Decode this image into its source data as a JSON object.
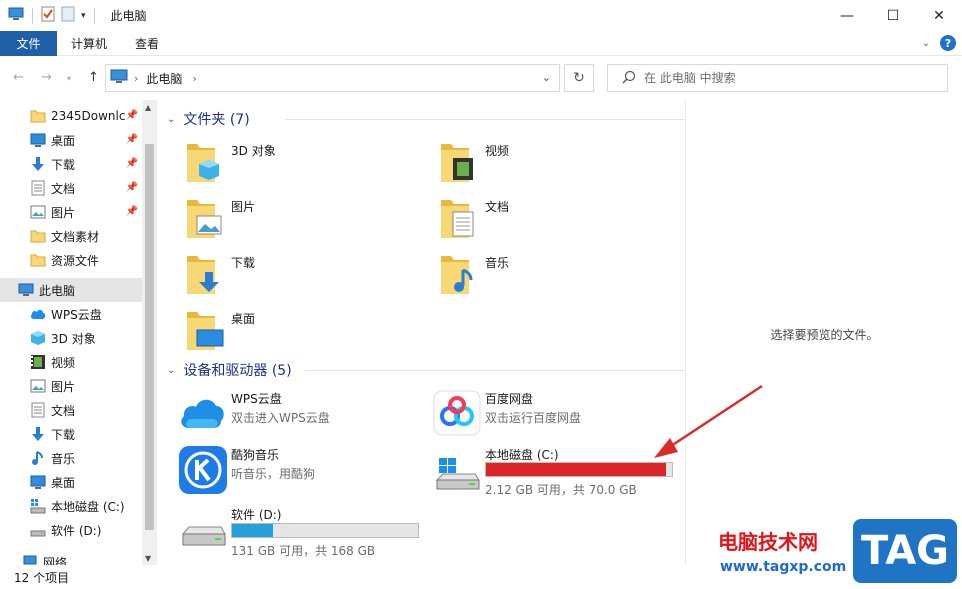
{
  "window": {
    "title": "此电脑",
    "minimize": "—",
    "maximize": "☐",
    "close": "✕"
  },
  "ribbon": {
    "tabs": [
      "文件",
      "计算机",
      "查看"
    ],
    "help": "?"
  },
  "address": {
    "crumb": "此电脑",
    "search_placeholder": "在 此电脑 中搜索"
  },
  "nav_pane": {
    "items": [
      {
        "label": "2345Downlc",
        "icon": "folder-icon",
        "pinned": true
      },
      {
        "label": "桌面",
        "icon": "desktop-icon",
        "pinned": true
      },
      {
        "label": "下载",
        "icon": "download-icon",
        "pinned": true
      },
      {
        "label": "文档",
        "icon": "document-icon",
        "pinned": true
      },
      {
        "label": "图片",
        "icon": "picture-icon",
        "pinned": true
      },
      {
        "label": "文档素材",
        "icon": "folder-icon",
        "pinned": false
      },
      {
        "label": "资源文件",
        "icon": "folder-icon",
        "pinned": false
      },
      {
        "label": "此电脑",
        "icon": "pc-icon",
        "pinned": false,
        "selected": true
      },
      {
        "label": "WPS云盘",
        "icon": "cloud-icon",
        "pinned": false
      },
      {
        "label": "3D 对象",
        "icon": "3d-object-icon",
        "pinned": false
      },
      {
        "label": "视频",
        "icon": "video-icon",
        "pinned": false
      },
      {
        "label": "图片",
        "icon": "picture-icon",
        "pinned": false
      },
      {
        "label": "文档",
        "icon": "document-icon",
        "pinned": false
      },
      {
        "label": "下载",
        "icon": "download-icon",
        "pinned": false
      },
      {
        "label": "音乐",
        "icon": "music-icon",
        "pinned": false
      },
      {
        "label": "桌面",
        "icon": "desktop-icon",
        "pinned": false
      },
      {
        "label": "本地磁盘 (C:)",
        "icon": "drive-c-icon",
        "pinned": false
      },
      {
        "label": "软件 (D:)",
        "icon": "drive-icon",
        "pinned": false
      },
      {
        "label": "网络",
        "icon": "network-icon",
        "pinned": false
      }
    ]
  },
  "content": {
    "folders_header": "文件夹 (7)",
    "folders": [
      {
        "label": "3D 对象",
        "icon": "3d-object-folder-icon"
      },
      {
        "label": "视频",
        "icon": "video-folder-icon"
      },
      {
        "label": "图片",
        "icon": "picture-folder-icon"
      },
      {
        "label": "文档",
        "icon": "document-folder-icon"
      },
      {
        "label": "下载",
        "icon": "download-folder-icon"
      },
      {
        "label": "音乐",
        "icon": "music-folder-icon"
      },
      {
        "label": "桌面",
        "icon": "desktop-folder-icon"
      }
    ],
    "devices_header": "设备和驱动器 (5)",
    "devices": {
      "wps": {
        "name": "WPS云盘",
        "sub": "双击进入WPS云盘"
      },
      "baidu": {
        "name": "百度网盘",
        "sub": "双击运行百度网盘"
      },
      "kugou": {
        "name": "酷狗音乐",
        "sub": "听音乐，用酷狗"
      },
      "c_drive": {
        "name": "本地磁盘 (C:)",
        "free": "2.12 GB 可用，共 70.0 GB",
        "used_fraction": 0.97,
        "bar_color": "#da2626"
      },
      "d_drive": {
        "name": "软件 (D:)",
        "free": "131 GB 可用，共 168 GB",
        "used_fraction": 0.22,
        "bar_color": "#26a0da"
      }
    }
  },
  "preview": {
    "text": "选择要预览的文件。"
  },
  "status": {
    "count": "12 个项目"
  },
  "watermark": {
    "line1": "电脑技术网",
    "line2": "www.tagxp.com",
    "badge": "TAG"
  }
}
